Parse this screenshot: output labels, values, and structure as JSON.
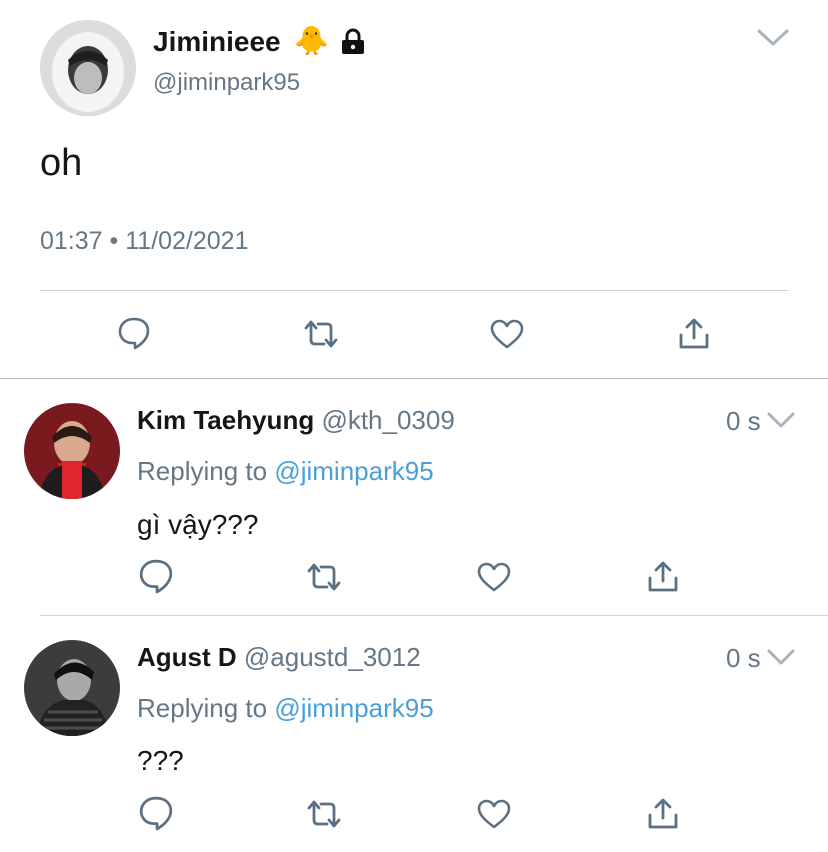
{
  "main_tweet": {
    "display_name": "Jiminieee",
    "name_emoji": "🐥",
    "handle": "@jiminpark95",
    "text": "oh",
    "timestamp": "01:37 • 11/02/2021",
    "icons": [
      "chevron-down-icon",
      "lock-icon",
      "reply-icon",
      "retweet-icon",
      "like-icon",
      "share-icon"
    ]
  },
  "replies": [
    {
      "display_name": "Kim Taehyung",
      "handle": "@kth_0309",
      "time": "0 s",
      "replying_prefix": "Replying to",
      "replying_to": "@jiminpark95",
      "text": "gì vậy???"
    },
    {
      "display_name": "Agust D",
      "handle": "@agustd_3012",
      "time": "0 s",
      "replying_prefix": "Replying to",
      "replying_to": "@jiminpark95",
      "text": "???"
    }
  ],
  "colors": {
    "link": "#4a9fd8",
    "secondary_text": "#657786",
    "icon": "#5b7083",
    "divider": "#cfd3d6"
  }
}
